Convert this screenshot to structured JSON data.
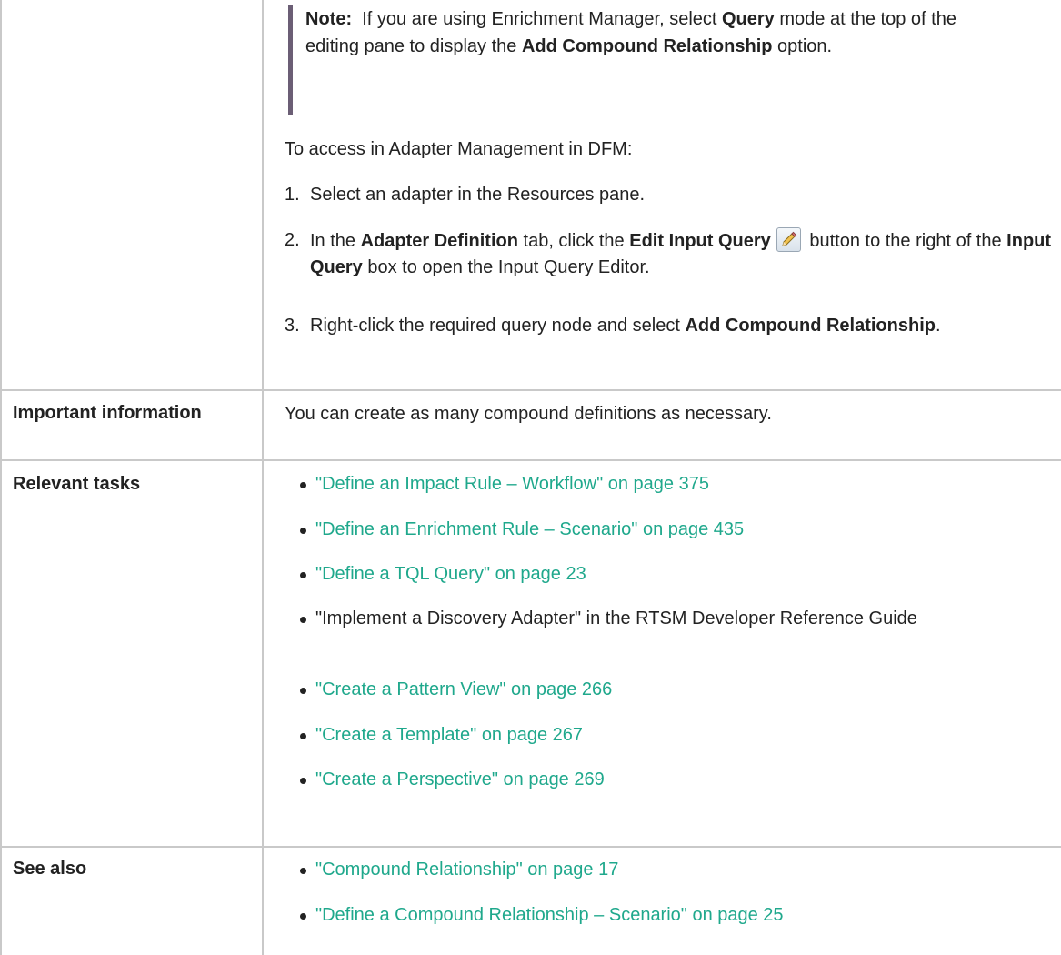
{
  "note": {
    "label": "Note:",
    "parts": [
      "If you are using Enrichment Manager, select ",
      "Query",
      " mode at the top of the editing pane to display the ",
      "Add Compound Relationship",
      " option."
    ]
  },
  "access": {
    "intro": "To access in Adapter Management in DFM:",
    "steps": [
      {
        "num": "1.",
        "parts": [
          "Select an adapter in the Resources pane."
        ]
      },
      {
        "num": "2.",
        "parts": [
          "In the ",
          "Adapter Definition",
          " tab, click the ",
          "Edit Input Query",
          " button to the right of the ",
          "Input Query",
          " box to open the Input Query Editor."
        ]
      },
      {
        "num": "3.",
        "parts": [
          "Right-click the required query node and select ",
          "Add Compound Relationship",
          "."
        ]
      }
    ]
  },
  "rows": {
    "important": {
      "label": "Important information",
      "text": "You can create as many compound definitions as necessary."
    },
    "relevant": {
      "label": "Relevant tasks",
      "items": [
        "\"Define an Impact Rule – Workflow\" on page 375",
        "\"Define an Enrichment Rule – Scenario\" on page 435",
        "\"Define a TQL Query\" on page 23",
        "\"Implement a Discovery Adapter\" in the RTSM Developer Reference Guide",
        "\"Create a Pattern View\" on page 266",
        "\"Create a Template\" on page 267",
        "\"Create a Perspective\" on page 269"
      ]
    },
    "see_also": {
      "label": "See also",
      "items": [
        "\"Compound Relationship\" on page 17",
        "\"Define a Compound Relationship – Scenario\" on page 25"
      ]
    }
  },
  "icons": {
    "edit_input_query": "pencil-edit-icon"
  },
  "colors": {
    "link": "#1fa88c",
    "note_bar": "#6b5e75",
    "border": "#c9c9c9",
    "text": "#222222"
  }
}
